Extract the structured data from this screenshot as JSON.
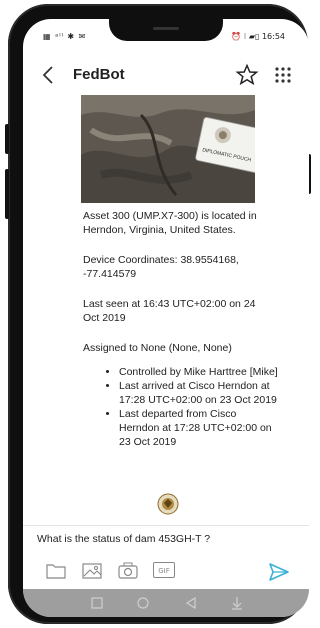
{
  "status_bar": {
    "left_indicators": "▦ ᵃˡˡ ✱ ✉",
    "right_indicators": "⏰ ⁝ ▰▯ 16:54"
  },
  "app_bar": {
    "title": "FedBot",
    "back_icon": "chevron-left-icon",
    "star_icon": "star-outline-icon",
    "menu_icon": "grid-dots-icon"
  },
  "photo": {
    "tag_text": "DIPLOMATIC POUCH"
  },
  "messages": [
    "Asset 300 (UMP.X7-300) is located in Herndon, Virginia, United States.",
    "Device Coordinates: 38.9554168, -77.414579",
    "Last seen at 16:43 UTC+02:00 on 24 Oct 2019",
    "Assigned to None (None, None)"
  ],
  "bullets": [
    "Controlled by Mike Harttree [Mike]",
    "Last arrived at Cisco Herndon at 17:28 UTC+02:00 on 23 Oct 2019",
    "Last departed from Cisco Herndon at 17:28 UTC+02:00 on 23 Oct 2019"
  ],
  "input": {
    "text": "What is the status of dam 453GH-T ?"
  },
  "toolbar": {
    "gif_label": "GIF",
    "icons": [
      "folder-icon",
      "image-icon",
      "camera-icon",
      "gif-icon",
      "send-icon"
    ]
  },
  "colors": {
    "accent": "#3bb0d6",
    "navbar": "#9e9e9e"
  }
}
